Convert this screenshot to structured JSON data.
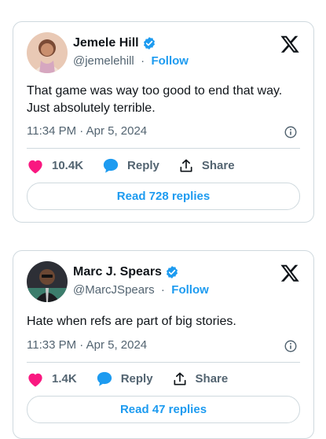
{
  "colors": {
    "accent": "#1d9bf0",
    "like": "#f91880",
    "muted": "#536471",
    "border": "#cfd9de"
  },
  "tweets": [
    {
      "name": "Jemele Hill",
      "handle": "@jemelehill",
      "separator": "·",
      "follow_label": "Follow",
      "text_line1": "That game was way too good to end that way.",
      "text_line2": "Just absolutely terrible.",
      "timestamp": "11:34 PM · Apr 5, 2024",
      "likes": "10.4K",
      "reply_label": "Reply",
      "share_label": "Share",
      "read_replies_label": "Read 728 replies",
      "icons": [
        "verified-badge-icon",
        "x-logo-icon",
        "info-icon",
        "heart-icon",
        "reply-bubble-icon",
        "share-icon"
      ]
    },
    {
      "name": "Marc J. Spears",
      "handle": "@MarcJSpears",
      "separator": "·",
      "follow_label": "Follow",
      "text_line1": "Hate when refs are part of big stories.",
      "timestamp": "11:33 PM · Apr 5, 2024",
      "likes": "1.4K",
      "reply_label": "Reply",
      "share_label": "Share",
      "read_replies_label": "Read 47 replies",
      "icons": [
        "verified-badge-icon",
        "x-logo-icon",
        "info-icon",
        "heart-icon",
        "reply-bubble-icon",
        "share-icon"
      ]
    }
  ]
}
